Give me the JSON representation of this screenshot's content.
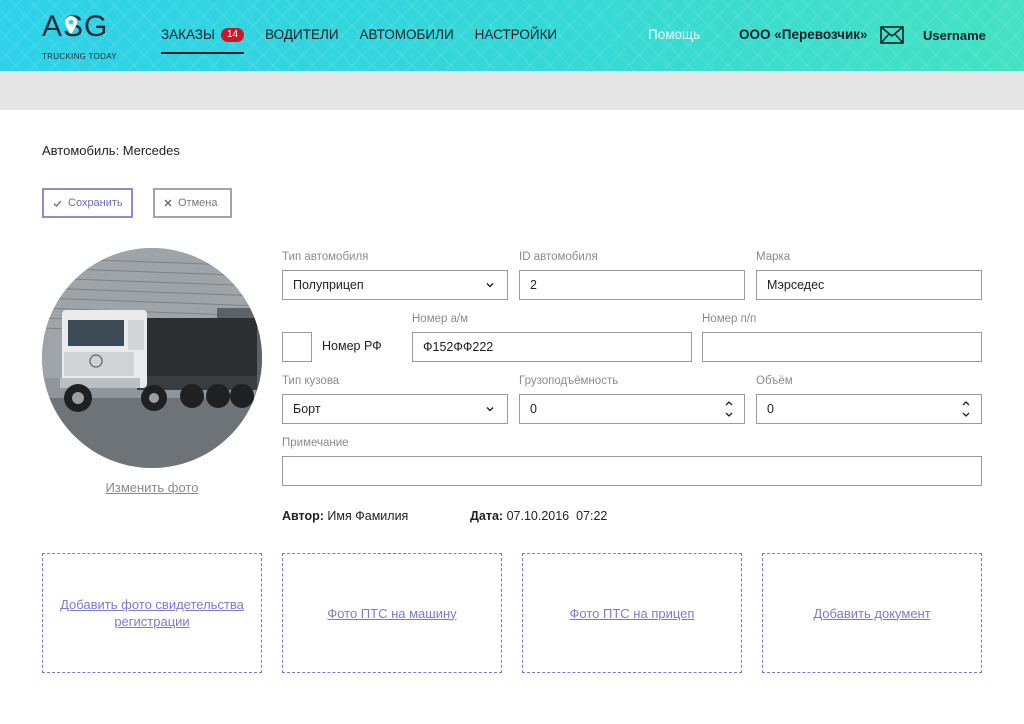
{
  "header": {
    "logo_text": "ASG",
    "logo_subtitle": "TRUCKING TODAY",
    "nav": [
      {
        "label": "ЗАКАЗЫ",
        "badge": "14"
      },
      {
        "label": "ВОДИТЕЛИ"
      },
      {
        "label": "АВТОМОБИЛИ"
      },
      {
        "label": "НАСТРОЙКИ"
      }
    ],
    "help": "Помощь",
    "company": "ООО «Перевозчик»",
    "mail_icon": "envelope-icon",
    "username": "Username"
  },
  "page": {
    "title": "Автомобиль: Mercedes",
    "save_label": "Сохранить",
    "cancel_label": "Отмена",
    "change_photo": "Изменить фото"
  },
  "form": {
    "vehicle_type": {
      "label": "Тип автомобиля",
      "value": "Полуприцеп"
    },
    "vehicle_id": {
      "label": "ID автомобиля",
      "value": "2"
    },
    "brand": {
      "label": "Марка",
      "value": "Мэрседес"
    },
    "rf_number": {
      "label": "Номер РФ",
      "checked": false
    },
    "plate": {
      "label": "Номер а/м",
      "value": "Ф152ФФ222"
    },
    "seq_number": {
      "label": "Номер п/п",
      "value": ""
    },
    "body_type": {
      "label": "Тип кузова",
      "value": "Борт"
    },
    "capacity": {
      "label": "Грузоподъёмность",
      "value": "0"
    },
    "volume": {
      "label": "Объём",
      "value": "0"
    },
    "note": {
      "label": "Примечание",
      "value": ""
    }
  },
  "meta": {
    "author_label": "Автор:",
    "author": "Имя Фамилия",
    "date_label": "Дата:",
    "date": "07.10.2016  07:22"
  },
  "uploads": [
    "Добавить фото свидетельства регистрации",
    "Фото ПТС на машину",
    "Фото ПТС на прицеп",
    "Добавить документ"
  ],
  "colors": {
    "accent": "#8b8bd6",
    "badge": "#d0152a",
    "header_start": "#2ed1e8",
    "header_end": "#44e2c2"
  }
}
